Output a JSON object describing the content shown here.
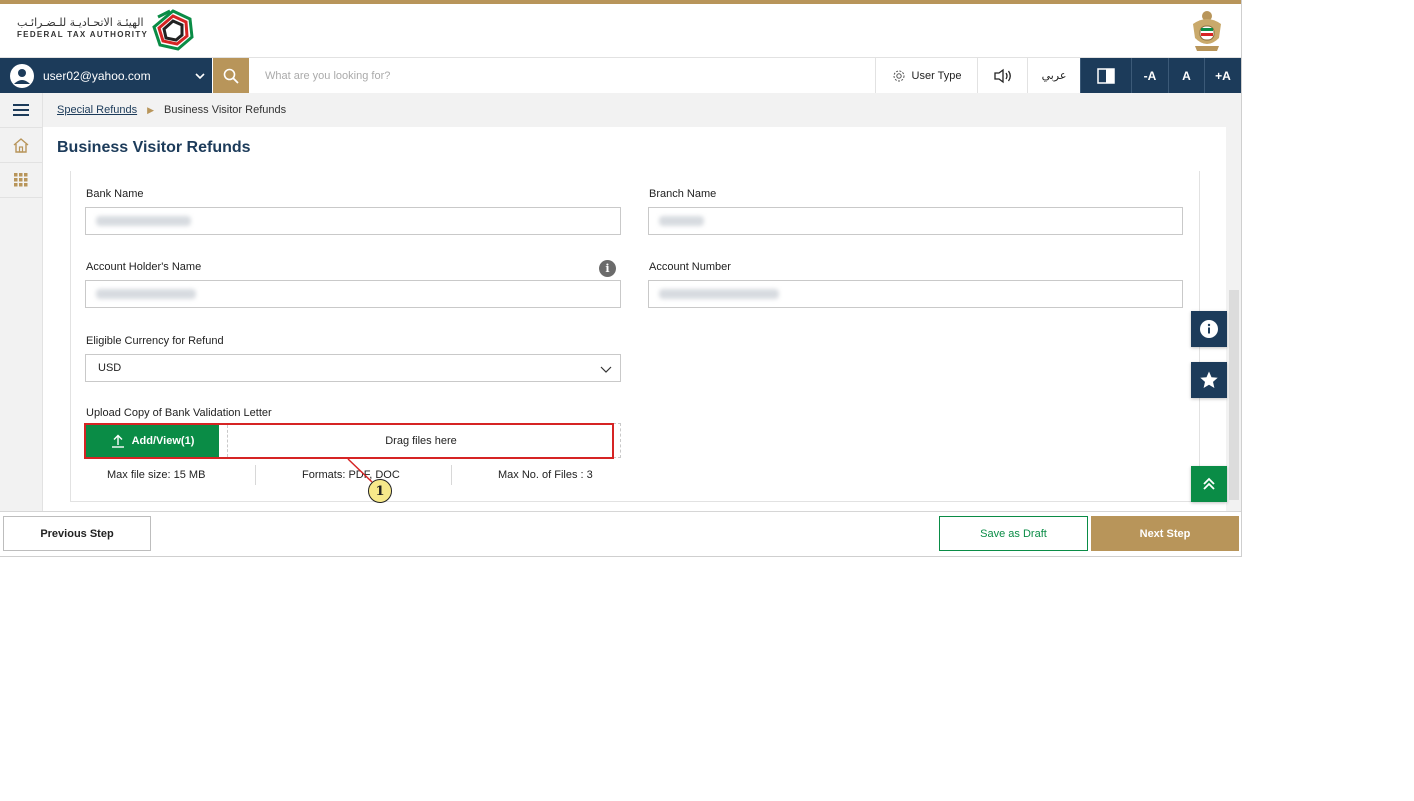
{
  "header": {
    "logo_arabic": "الهيئـة الاتحـاديـة للـضـرائـب",
    "logo_english": "FEDERAL TAX AUTHORITY"
  },
  "nav": {
    "user_email": "user02@yahoo.com",
    "search_placeholder": "What are you looking for?",
    "user_type_label": "User Type",
    "arabic_label": "عربي",
    "font_decrease": "-A",
    "font_normal": "A",
    "font_increase": "+A"
  },
  "breadcrumb": {
    "parent": "Special Refunds",
    "current": "Business Visitor Refunds"
  },
  "page": {
    "title": "Business Visitor Refunds"
  },
  "form": {
    "bank_name_label": "Bank Name",
    "branch_name_label": "Branch Name",
    "account_holder_label": "Account Holder's Name",
    "account_number_label": "Account Number",
    "currency_label": "Eligible Currency for Refund",
    "currency_value": "USD",
    "upload_label": "Upload Copy of Bank Validation Letter",
    "add_view_label": "Add/View(1)",
    "drag_text": "Drag files here",
    "max_size": "Max file size: 15 MB",
    "formats": "Formats: PDF, DOC",
    "max_files": "Max No. of Files : 3"
  },
  "annotation": {
    "callout_number": "1",
    "callout_color": "#f7e98a",
    "highlight_color": "#d62424"
  },
  "footer": {
    "previous": "Previous Step",
    "save_draft": "Save as Draft",
    "next": "Next Step"
  },
  "colors": {
    "navy": "#1c3b5a",
    "gold": "#b8955a",
    "green": "#0a8c46"
  }
}
